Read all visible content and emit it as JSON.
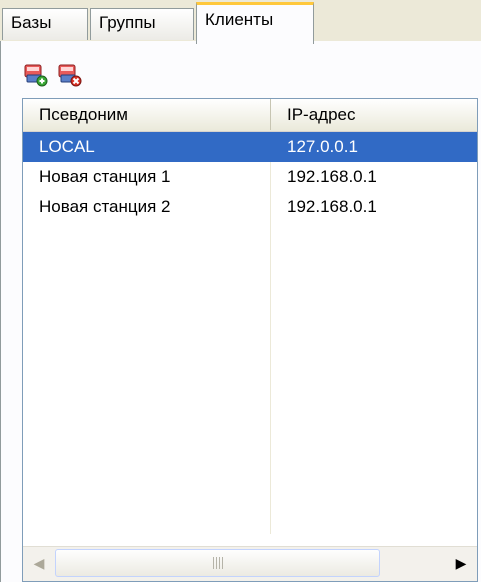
{
  "tabs": [
    {
      "label": "Базы"
    },
    {
      "label": "Группы"
    },
    {
      "label": "Клиенты",
      "active": true
    }
  ],
  "toolbar": {
    "add_icon": "add-station-icon",
    "delete_icon": "delete-station-icon"
  },
  "list": {
    "columns": [
      "Псевдоним",
      "IP-адрес"
    ],
    "rows": [
      {
        "alias": "LOCAL",
        "ip": "127.0.0.1",
        "selected": true
      },
      {
        "alias": "Новая станция 1",
        "ip": "192.168.0.1"
      },
      {
        "alias": "Новая станция 2",
        "ip": "192.168.0.1"
      }
    ]
  },
  "colors": {
    "selection": "#316ac5",
    "active_tab_accent": "#ffc83c"
  }
}
